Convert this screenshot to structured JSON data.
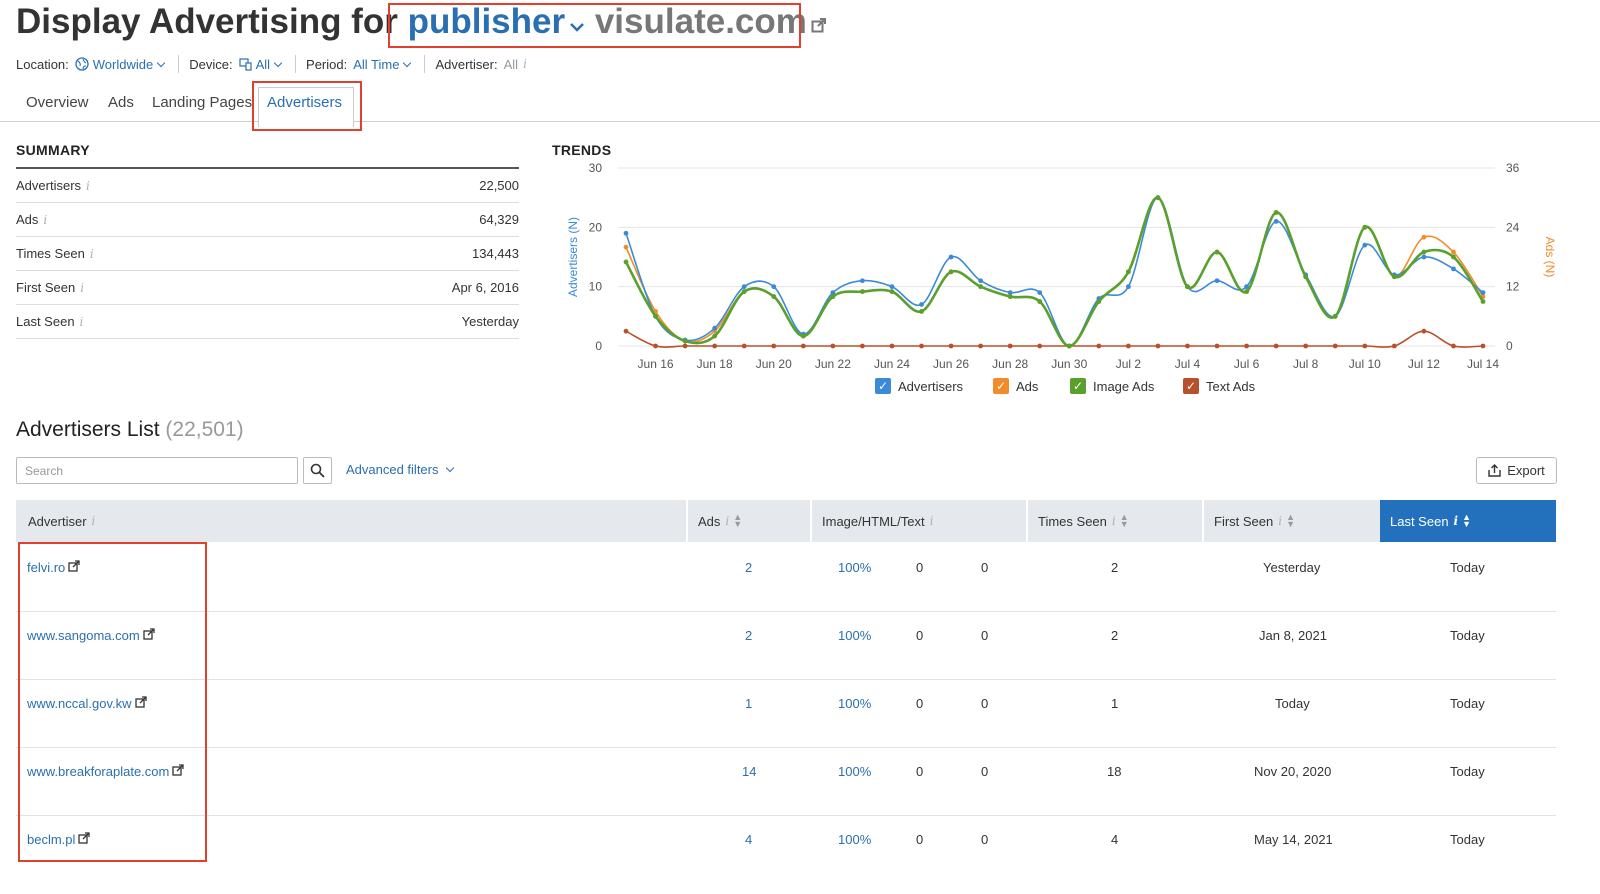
{
  "header": {
    "title_prefix": "Display Advertising for",
    "mode": "publisher",
    "domain": "visulate.com"
  },
  "filters": {
    "location_label": "Location:",
    "location_value": "Worldwide",
    "device_label": "Device:",
    "device_value": "All",
    "period_label": "Period:",
    "period_value": "All Time",
    "advertiser_label": "Advertiser:",
    "advertiser_value": "All"
  },
  "tabs": [
    {
      "label": "Overview"
    },
    {
      "label": "Ads"
    },
    {
      "label": "Landing Pages"
    },
    {
      "label": "Advertisers",
      "active": true
    }
  ],
  "summary": {
    "title": "SUMMARY",
    "rows": [
      {
        "label": "Advertisers",
        "value": "22,500"
      },
      {
        "label": "Ads",
        "value": "64,329"
      },
      {
        "label": "Times Seen",
        "value": "134,443"
      },
      {
        "label": "First Seen",
        "value": "Apr 6, 2016"
      },
      {
        "label": "Last Seen",
        "value": "Yesterday"
      }
    ]
  },
  "chart_data": {
    "type": "line",
    "title": "TRENDS",
    "ylabel": "Advertisers (N)",
    "y2label": "Ads (N)",
    "ylim": [
      0,
      30
    ],
    "y2lim": [
      0,
      36
    ],
    "yticks": [
      0,
      10,
      20,
      30
    ],
    "y2ticks": [
      0,
      12,
      24,
      36
    ],
    "x_tick_labels": [
      "Jun 16",
      "Jun 18",
      "Jun 20",
      "Jun 22",
      "Jun 24",
      "Jun 26",
      "Jun 28",
      "Jun 30",
      "Jul 2",
      "Jul 4",
      "Jul 6",
      "Jul 8",
      "Jul 10",
      "Jul 12",
      "Jul 14"
    ],
    "x": [
      "Jun 15",
      "Jun 16",
      "Jun 17",
      "Jun 18",
      "Jun 19",
      "Jun 20",
      "Jun 21",
      "Jun 22",
      "Jun 23",
      "Jun 24",
      "Jun 25",
      "Jun 26",
      "Jun 27",
      "Jun 28",
      "Jun 29",
      "Jun 30",
      "Jul 1",
      "Jul 2",
      "Jul 3",
      "Jul 4",
      "Jul 5",
      "Jul 6",
      "Jul 7",
      "Jul 8",
      "Jul 9",
      "Jul 10",
      "Jul 11",
      "Jul 12",
      "Jul 13",
      "Jul 14"
    ],
    "series": [
      {
        "name": "Advertisers",
        "color": "#3a8ad8",
        "axis": "left",
        "values": [
          19,
          5,
          1,
          3,
          10,
          10,
          2,
          9,
          11,
          10,
          7,
          15,
          11,
          9,
          9,
          0,
          8,
          10,
          25,
          10,
          11,
          10,
          21,
          12,
          5,
          17,
          12,
          15,
          13,
          9
        ]
      },
      {
        "name": "Ads",
        "color": "#f08c2b",
        "axis": "right",
        "values": [
          20,
          7,
          1,
          3,
          11,
          10,
          2,
          10,
          11,
          11,
          7,
          15,
          12,
          10,
          9,
          0,
          9,
          15,
          30,
          12,
          19,
          11,
          27,
          14,
          6,
          24,
          14,
          22,
          19,
          10
        ]
      },
      {
        "name": "Image Ads",
        "color": "#5aa02c",
        "axis": "right",
        "values": [
          17,
          6,
          1,
          2,
          11,
          10,
          2,
          10,
          11,
          11,
          7,
          15,
          12,
          10,
          9,
          0,
          9,
          15,
          30,
          12,
          19,
          11,
          27,
          14,
          6,
          24,
          14,
          19,
          18,
          9
        ]
      },
      {
        "name": "Text Ads",
        "color": "#b8512b",
        "axis": "right",
        "values": [
          3,
          0,
          0,
          0,
          0,
          0,
          0,
          0,
          0,
          0,
          0,
          0,
          0,
          0,
          0,
          0,
          0,
          0,
          0,
          0,
          0,
          0,
          0,
          0,
          0,
          0,
          0,
          3,
          0,
          0
        ]
      }
    ],
    "legend": [
      "Advertisers",
      "Ads",
      "Image Ads",
      "Text Ads"
    ],
    "grid": true,
    "legend_position": "bottom"
  },
  "list": {
    "title": "Advertisers List",
    "count": "(22,501)",
    "search_placeholder": "Search",
    "advanced_filters": "Advanced filters",
    "export": "Export",
    "columns": [
      "Advertiser",
      "Ads",
      "Image/HTML/Text",
      "Times Seen",
      "First Seen",
      "Last Seen"
    ],
    "rows": [
      {
        "advertiser": "felvi.ro",
        "ads": "2",
        "image": "100%",
        "html": "0",
        "text": "0",
        "times_seen": "2",
        "first_seen": "Yesterday",
        "last_seen": "Today"
      },
      {
        "advertiser": "www.sangoma.com",
        "ads": "2",
        "image": "100%",
        "html": "0",
        "text": "0",
        "times_seen": "2",
        "first_seen": "Jan 8, 2021",
        "last_seen": "Today"
      },
      {
        "advertiser": "www.nccal.gov.kw",
        "ads": "1",
        "image": "100%",
        "html": "0",
        "text": "0",
        "times_seen": "1",
        "first_seen": "Today",
        "last_seen": "Today"
      },
      {
        "advertiser": "www.breakforaplate.com",
        "ads": "14",
        "image": "100%",
        "html": "0",
        "text": "0",
        "times_seen": "18",
        "first_seen": "Nov 20, 2020",
        "last_seen": "Today"
      },
      {
        "advertiser": "beclm.pl",
        "ads": "4",
        "image": "100%",
        "html": "0",
        "text": "0",
        "times_seen": "4",
        "first_seen": "May 14, 2021",
        "last_seen": "Today"
      }
    ]
  },
  "colors": {
    "accent": "#2a6fb0",
    "highlight": "#e0412f",
    "active_header": "#2370bd"
  }
}
